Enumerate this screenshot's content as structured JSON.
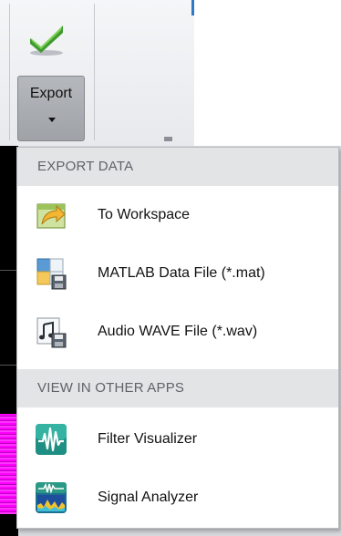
{
  "toolstrip": {
    "export_button": {
      "label": "Export",
      "icon": "green-check-icon",
      "has_dropdown": true
    }
  },
  "colors": {
    "menu_background": "#ffffff",
    "section_header_background": "#e3e4e6",
    "section_header_text": "#5f6368",
    "accent_blue": "#2f78c7",
    "plot_trace": "#ff00ff"
  },
  "menu": {
    "sections": [
      {
        "header": "EXPORT DATA",
        "items": [
          {
            "label": "To Workspace",
            "icon": "workspace-icon"
          },
          {
            "label": "MATLAB Data File (*.mat)",
            "icon": "mat-file-icon"
          },
          {
            "label": "Audio WAVE File (*.wav)",
            "icon": "wav-file-icon"
          }
        ]
      },
      {
        "header": "VIEW IN OTHER APPS",
        "items": [
          {
            "label": "Filter Visualizer",
            "icon": "filter-visualizer-icon"
          },
          {
            "label": "Signal Analyzer",
            "icon": "signal-analyzer-icon"
          }
        ]
      }
    ]
  }
}
